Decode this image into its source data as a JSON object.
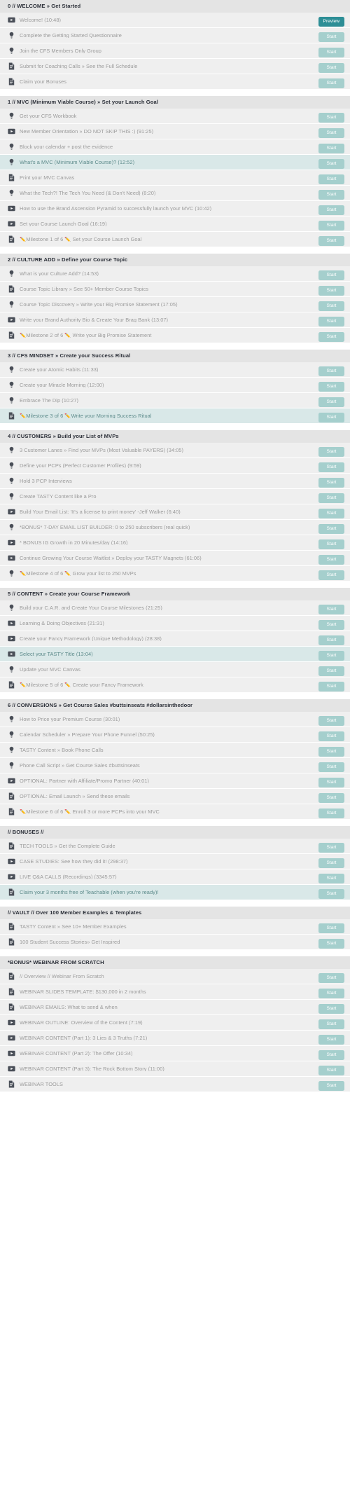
{
  "colors": {
    "start_button": "#a5cfcd",
    "preview_button": "#2d8e96",
    "section_header_bg": "#e4e4e4",
    "row_bg": "#efefef",
    "row_highlight_bg": "#d9e8e8",
    "row_text": "#9b9b9b",
    "row_highlight_text": "#5c8a8a",
    "header_text": "#2b2f38"
  },
  "labels": {
    "start": "Start",
    "preview": "Preview"
  },
  "sections": [
    {
      "title": "0 // WELCOME » Get Started",
      "rows": [
        {
          "icon": "video-icon",
          "label": "Welcome! (10:48)",
          "action": "Preview",
          "action_kind": "preview",
          "highlight": false
        },
        {
          "icon": "lightbulb-icon",
          "label": "Complete the Getting Started Questionnaire",
          "action": "Start",
          "action_kind": "start",
          "highlight": false
        },
        {
          "icon": "lightbulb-icon",
          "label": "Join the CFS Members Only Group",
          "action": "Start",
          "action_kind": "start",
          "highlight": false
        },
        {
          "icon": "document-icon",
          "label": "Submit for Coaching Calls » See the Full Schedule",
          "action": "Start",
          "action_kind": "start",
          "highlight": false
        },
        {
          "icon": "document-icon",
          "label": "Claim your Bonuses",
          "action": "Start",
          "action_kind": "start",
          "highlight": false
        }
      ]
    },
    {
      "title": "1 // MVC (Minimum Viable Course) » Set your Launch Goal",
      "rows": [
        {
          "icon": "lightbulb-icon",
          "label": "Get your CFS Workbook",
          "action": "Start",
          "action_kind": "start",
          "highlight": false
        },
        {
          "icon": "video-icon",
          "label": "New Member Orientation » DO NOT SKIP THIS :) (91:25)",
          "action": "Start",
          "action_kind": "start",
          "highlight": false
        },
        {
          "icon": "lightbulb-icon",
          "label": "Block your calendar + post the evidence",
          "action": "Start",
          "action_kind": "start",
          "highlight": false
        },
        {
          "icon": "lightbulb-icon",
          "label": "What's a MVC (Minimum Viable Course)? (12:52)",
          "action": "Start",
          "action_kind": "start",
          "highlight": true
        },
        {
          "icon": "document-icon",
          "label": "Print your MVC Canvas",
          "action": "Start",
          "action_kind": "start",
          "highlight": false
        },
        {
          "icon": "lightbulb-icon",
          "label": "What the Tech?! The Tech You Need (& Don't Need) (8:20)",
          "action": "Start",
          "action_kind": "start",
          "highlight": false
        },
        {
          "icon": "video-icon",
          "label": "How to use the Brand Ascension Pyramid to successfully launch your MVC (10:42)",
          "action": "Start",
          "action_kind": "start",
          "highlight": false
        },
        {
          "icon": "video-icon",
          "label": "Set your Course Launch Goal (16:19)",
          "action": "Start",
          "action_kind": "start",
          "highlight": false
        },
        {
          "icon": "document-icon",
          "label": "✏️Milestone 1 of 6 ✏️ Set your Course Launch Goal",
          "action": "Start",
          "action_kind": "start",
          "highlight": false
        }
      ]
    },
    {
      "title": "2 // CULTURE ADD » Define your Course Topic",
      "rows": [
        {
          "icon": "lightbulb-icon",
          "label": "What is your Culture Add? (14:53)",
          "action": "Start",
          "action_kind": "start",
          "highlight": false
        },
        {
          "icon": "document-icon",
          "label": "Course Topic Library » See 50+ Member Course Topics",
          "action": "Start",
          "action_kind": "start",
          "highlight": false
        },
        {
          "icon": "lightbulb-icon",
          "label": "Course Topic Discovery » Write your Big Promise Statement (17:05)",
          "action": "Start",
          "action_kind": "start",
          "highlight": false
        },
        {
          "icon": "video-icon",
          "label": "Write your Brand Authority Bio & Create Your Brag Bank (13:07)",
          "action": "Start",
          "action_kind": "start",
          "highlight": false
        },
        {
          "icon": "document-icon",
          "label": "✏️Milestone 2 of 6 ✏️ Write your Big Promise Statement",
          "action": "Start",
          "action_kind": "start",
          "highlight": false
        }
      ]
    },
    {
      "title": "3 // CFS MINDSET » Create your Success Ritual",
      "rows": [
        {
          "icon": "lightbulb-icon",
          "label": "Create your Atomic Habits (11:33)",
          "action": "Start",
          "action_kind": "start",
          "highlight": false
        },
        {
          "icon": "lightbulb-icon",
          "label": "Create your Miracle Morning (12:00)",
          "action": "Start",
          "action_kind": "start",
          "highlight": false
        },
        {
          "icon": "lightbulb-icon",
          "label": "Embrace The Dip (10:27)",
          "action": "Start",
          "action_kind": "start",
          "highlight": false
        },
        {
          "icon": "document-icon",
          "label": "✏️Milestone 3 of 6 ✏️Write your Morning Success Ritual",
          "action": "Start",
          "action_kind": "start",
          "highlight": true
        }
      ]
    },
    {
      "title": "4 // CUSTOMERS » Build your List of MVPs",
      "rows": [
        {
          "icon": "lightbulb-icon",
          "label": "3 Customer Lanes » Find your MVPs (Most Valuable PAYERS) (34:05)",
          "action": "Start",
          "action_kind": "start",
          "highlight": false
        },
        {
          "icon": "lightbulb-icon",
          "label": "Define your PCPs (Perfect Customer Profiles) (9:59)",
          "action": "Start",
          "action_kind": "start",
          "highlight": false
        },
        {
          "icon": "lightbulb-icon",
          "label": "Hold 3 PCP Interviews",
          "action": "Start",
          "action_kind": "start",
          "highlight": false
        },
        {
          "icon": "lightbulb-icon",
          "label": "Create TASTY Content like a Pro",
          "action": "Start",
          "action_kind": "start",
          "highlight": false
        },
        {
          "icon": "video-icon",
          "label": "Build Your Email List: 'It's a license to print money' -Jeff Walker (6:40)",
          "action": "Start",
          "action_kind": "start",
          "highlight": false
        },
        {
          "icon": "lightbulb-icon",
          "label": "*BONUS* 7-DAY EMAIL LIST BUILDER: 0 to 250 subscribers (real quick)",
          "action": "Start",
          "action_kind": "start",
          "highlight": false
        },
        {
          "icon": "video-icon",
          "label": "* BONUS IG Growth in 20 Minutes/day (14:16)",
          "action": "Start",
          "action_kind": "start",
          "highlight": false
        },
        {
          "icon": "video-icon",
          "label": "Continue Growing Your Course Waitlist » Deploy your TASTY Magnets (61:06)",
          "action": "Start",
          "action_kind": "start",
          "highlight": false
        },
        {
          "icon": "lightbulb-icon",
          "label": "✏️Milestone 4 of 6 ✏️ Grow your list to 250 MVPs",
          "action": "Start",
          "action_kind": "start",
          "highlight": false
        }
      ]
    },
    {
      "title": "5 // CONTENT » Create your Course Framework",
      "rows": [
        {
          "icon": "lightbulb-icon",
          "label": "Build your C.A.R. and Create Your Course Milestones (21:25)",
          "action": "Start",
          "action_kind": "start",
          "highlight": false
        },
        {
          "icon": "video-icon",
          "label": "Learning & Doing Objectives (21:31)",
          "action": "Start",
          "action_kind": "start",
          "highlight": false
        },
        {
          "icon": "video-icon",
          "label": "Create your Fancy Framework (Unique Methodology) (28:38)",
          "action": "Start",
          "action_kind": "start",
          "highlight": false
        },
        {
          "icon": "video-icon",
          "label": "Select your TASTY Title (13:04)",
          "action": "Start",
          "action_kind": "start",
          "highlight": true
        },
        {
          "icon": "lightbulb-icon",
          "label": "Update your MVC Canvas",
          "action": "Start",
          "action_kind": "start",
          "highlight": false
        },
        {
          "icon": "document-icon",
          "label": "✏️Milestone 5 of 6 ✏️ Create your Fancy Framework",
          "action": "Start",
          "action_kind": "start",
          "highlight": false
        }
      ]
    },
    {
      "title": "6 // CONVERSIONS » Get Course Sales #buttsinseats #dollarsinthedoor",
      "rows": [
        {
          "icon": "lightbulb-icon",
          "label": "How to Price your Premium Course (30:01)",
          "action": "Start",
          "action_kind": "start",
          "highlight": false
        },
        {
          "icon": "lightbulb-icon",
          "label": "Calendar Scheduler » Prepare Your Phone Funnel (50:25)",
          "action": "Start",
          "action_kind": "start",
          "highlight": false
        },
        {
          "icon": "lightbulb-icon",
          "label": "TASTY Content » Book Phone Calls",
          "action": "Start",
          "action_kind": "start",
          "highlight": false
        },
        {
          "icon": "lightbulb-icon",
          "label": "Phone Call Script » Get Course Sales #buttsinseats",
          "action": "Start",
          "action_kind": "start",
          "highlight": false
        },
        {
          "icon": "video-icon",
          "label": "OPTIONAL: Partner with Affiliate/Promo Partner (40:01)",
          "action": "Start",
          "action_kind": "start",
          "highlight": false
        },
        {
          "icon": "document-icon",
          "label": "OPTIONAL: Email Launch » Send these emails",
          "action": "Start",
          "action_kind": "start",
          "highlight": false
        },
        {
          "icon": "document-icon",
          "label": "✏️Milestone 6 of 6 ✏️ Enroll 3 or more PCPs into your MVC",
          "action": "Start",
          "action_kind": "start",
          "highlight": false
        }
      ]
    },
    {
      "title": "// BONUSES //",
      "rows": [
        {
          "icon": "document-icon",
          "label": "TECH TOOLS » Get the Complete Guide",
          "action": "Start",
          "action_kind": "start",
          "highlight": false
        },
        {
          "icon": "video-icon",
          "label": "CASE STUDIES: See how they did it! (298:37)",
          "action": "Start",
          "action_kind": "start",
          "highlight": false
        },
        {
          "icon": "video-icon",
          "label": "LIVE Q&A CALLS (Recordings) (3345:57)",
          "action": "Start",
          "action_kind": "start",
          "highlight": false
        },
        {
          "icon": "document-icon",
          "label": "Claim your 3 months free of Teachable (when you're ready)!",
          "action": "Start",
          "action_kind": "start",
          "highlight": true
        }
      ]
    },
    {
      "title": "// VAULT // Over 100 Member Examples & Templates",
      "rows": [
        {
          "icon": "document-icon",
          "label": "TASTY Content » See 10+ Member Examples",
          "action": "Start",
          "action_kind": "start",
          "highlight": false
        },
        {
          "icon": "document-icon",
          "label": "100 Student Success Stories» Get Inspired",
          "action": "Start",
          "action_kind": "start",
          "highlight": false
        }
      ]
    },
    {
      "title": "*BONUS* WEBINAR FROM SCRATCH",
      "rows": [
        {
          "icon": "document-icon",
          "label": "// Overview // Webinar From Scratch",
          "action": "Start",
          "action_kind": "start",
          "highlight": false
        },
        {
          "icon": "document-icon",
          "label": "WEBINAR SLIDES TEMPLATE: $130,000 in 2 months",
          "action": "Start",
          "action_kind": "start",
          "highlight": false
        },
        {
          "icon": "document-icon",
          "label": "WEBINAR EMAILS: What to send & when",
          "action": "Start",
          "action_kind": "start",
          "highlight": false
        },
        {
          "icon": "video-icon",
          "label": "WEBINAR OUTLINE: Overview of the Content (7:19)",
          "action": "Start",
          "action_kind": "start",
          "highlight": false
        },
        {
          "icon": "video-icon",
          "label": "WEBINAR CONTENT (Part 1): 3 Lies & 3 Truths (7:21)",
          "action": "Start",
          "action_kind": "start",
          "highlight": false
        },
        {
          "icon": "video-icon",
          "label": "WEBINAR CONTENT (Part 2): The Offer (10:34)",
          "action": "Start",
          "action_kind": "start",
          "highlight": false
        },
        {
          "icon": "video-icon",
          "label": "WEBINAR CONTENT (Part 3): The Rock Bottom Story (11:00)",
          "action": "Start",
          "action_kind": "start",
          "highlight": false
        },
        {
          "icon": "document-icon",
          "label": "WEBINAR TOOLS",
          "action": "Start",
          "action_kind": "start",
          "highlight": false
        }
      ]
    }
  ]
}
